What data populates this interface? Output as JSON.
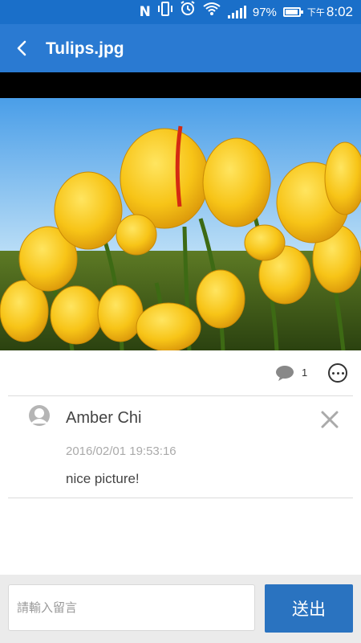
{
  "status_bar": {
    "nfc_icon": "nfc-icon",
    "vibrate_icon": "vibrate-icon",
    "alarm_icon": "alarm-icon",
    "wifi_icon": "wifi-icon",
    "signal_icon": "signal-icon",
    "battery_percent": "97%",
    "battery_level": 0.97,
    "time_prefix": "下午",
    "time": "8:02"
  },
  "app_bar": {
    "title": "Tulips.jpg",
    "back_icon": "back-arrow-icon",
    "color": "#2a7ad2"
  },
  "photo": {
    "subject": "tulips"
  },
  "actions": {
    "comment_icon": "comment-bubble-icon",
    "comment_count": "1",
    "more_icon": "more-options-icon"
  },
  "comments": [
    {
      "author": "Amber Chi",
      "timestamp": "2016/02/01 19:53:16",
      "text": "nice picture!",
      "avatar_icon": "user-avatar-icon",
      "delete_icon": "close-icon"
    }
  ],
  "composer": {
    "placeholder": "請輸入留言",
    "value": "",
    "send_label": "送出",
    "send_color": "#2a73c0"
  }
}
